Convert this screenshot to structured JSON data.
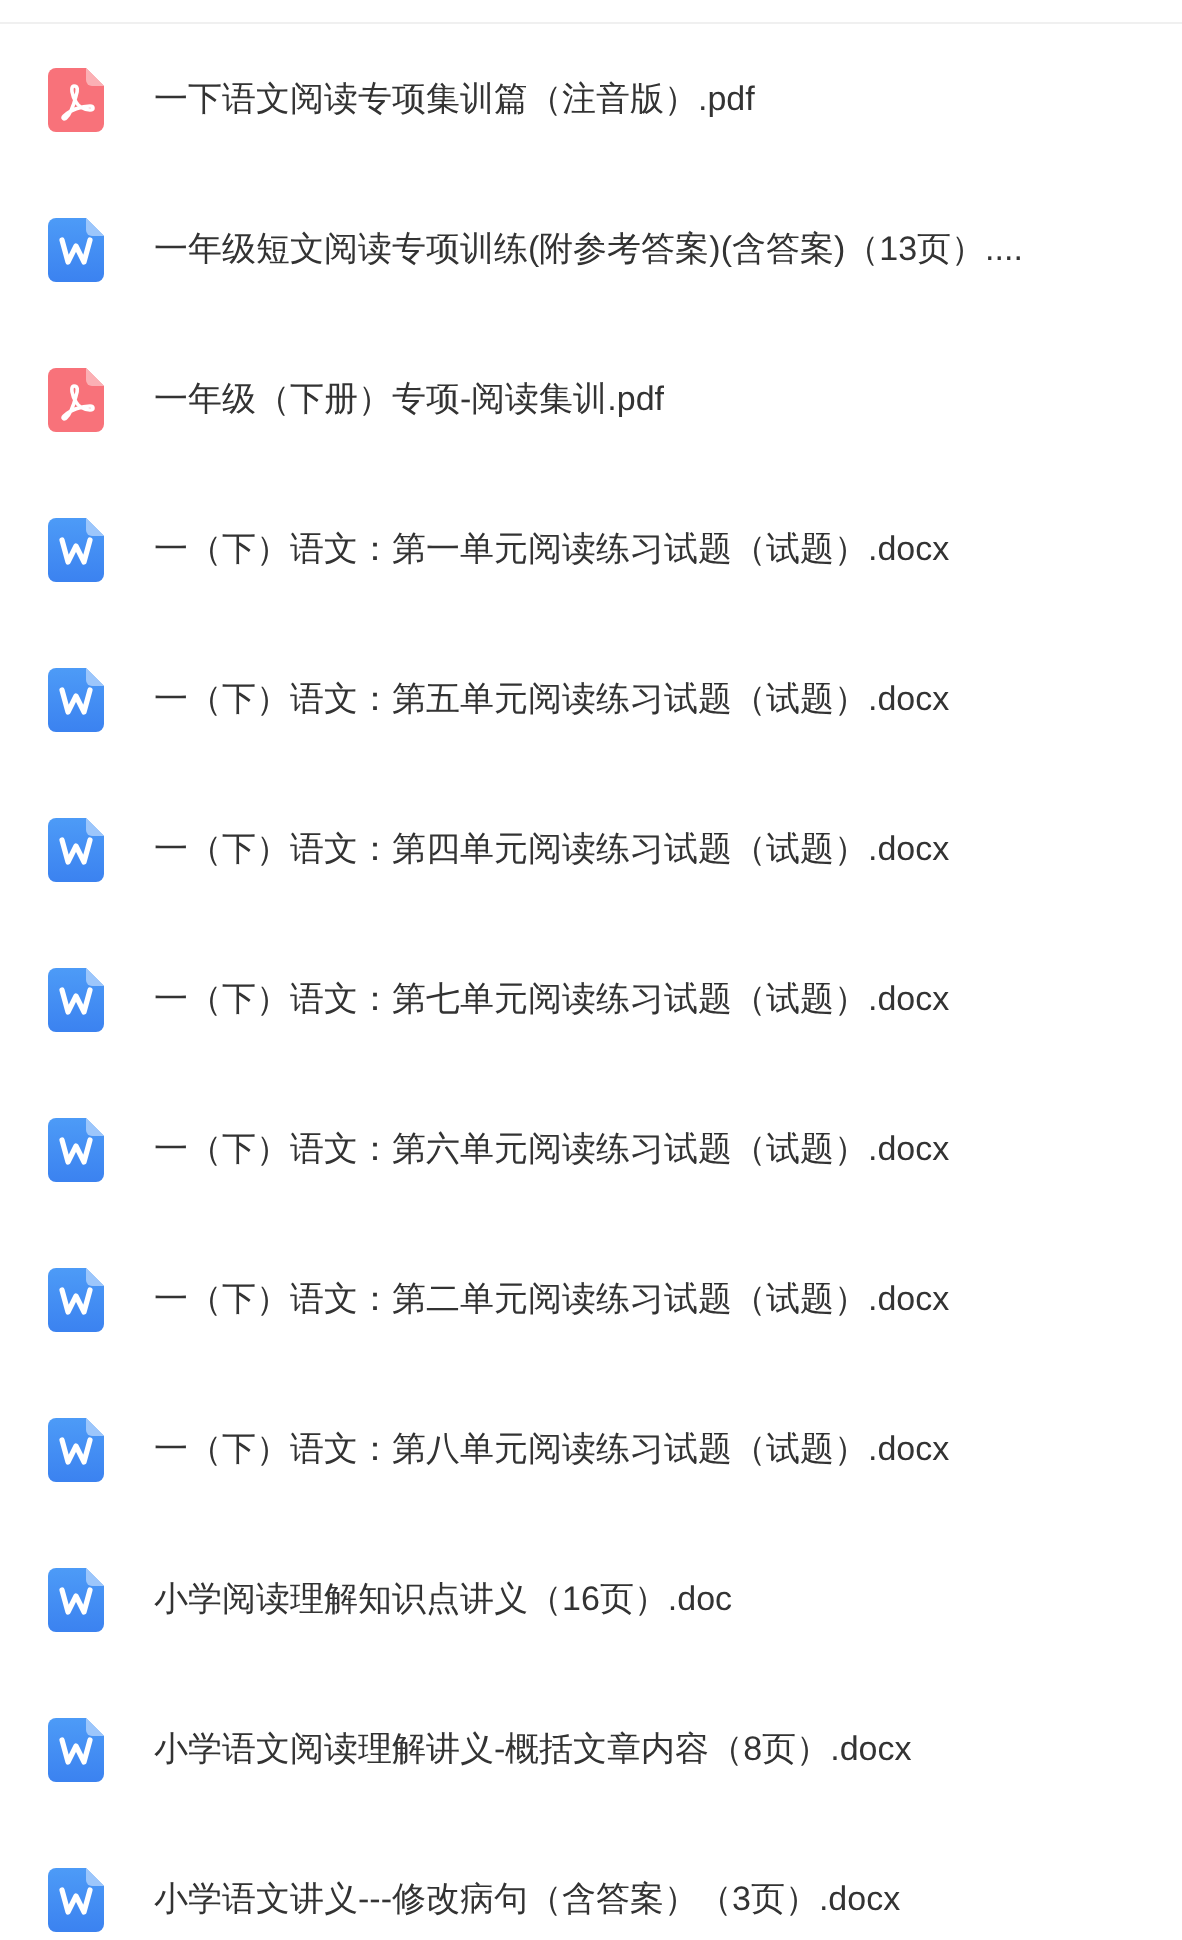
{
  "files": [
    {
      "kind": "pdf",
      "name": "一下语文阅读专项集训篇（注音版）.pdf"
    },
    {
      "kind": "word",
      "name": "一年级短文阅读专项训练(附参考答案)(含答案)（13页）...."
    },
    {
      "kind": "pdf",
      "name": "一年级（下册）专项-阅读集训.pdf"
    },
    {
      "kind": "word",
      "name": "一（下）语文：第一单元阅读练习试题（试题）.docx"
    },
    {
      "kind": "word",
      "name": "一（下）语文：第五单元阅读练习试题（试题）.docx"
    },
    {
      "kind": "word",
      "name": "一（下）语文：第四单元阅读练习试题（试题）.docx"
    },
    {
      "kind": "word",
      "name": "一（下）语文：第七单元阅读练习试题（试题）.docx"
    },
    {
      "kind": "word",
      "name": "一（下）语文：第六单元阅读练习试题（试题）.docx"
    },
    {
      "kind": "word",
      "name": "一（下）语文：第二单元阅读练习试题（试题）.docx"
    },
    {
      "kind": "word",
      "name": "一（下）语文：第八单元阅读练习试题（试题）.docx"
    },
    {
      "kind": "word",
      "name": "小学阅读理解知识点讲义（16页）.doc"
    },
    {
      "kind": "word",
      "name": "小学语文阅读理解讲义-概括文章内容（8页）.docx"
    },
    {
      "kind": "word",
      "name": "小学语文讲义---修改病句（含答案）（3页）.docx"
    }
  ]
}
